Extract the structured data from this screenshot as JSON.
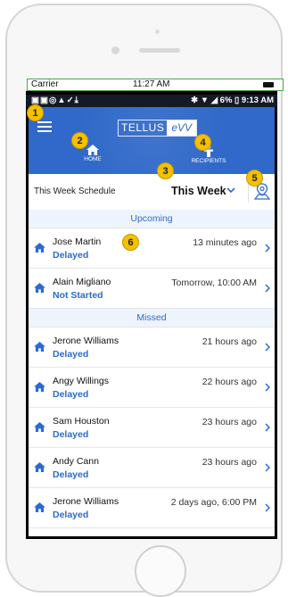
{
  "ios_status": {
    "carrier": "Carrier",
    "time": "11:27 AM"
  },
  "android_status": {
    "left_icons": "▣▣◎▲✓⤓",
    "right": "✱ ▼ ◢ 6% ▯ 9:13 AM"
  },
  "header": {
    "logo_part1": "TELLUS",
    "logo_part2": "eVV",
    "nav": [
      {
        "label": "HOME",
        "icon": "home-icon"
      },
      {
        "label": "RECIPIENTS",
        "icon": "person-icon"
      }
    ],
    "color": "#3069c9"
  },
  "schedule": {
    "label": "This Week Schedule",
    "selected": "This Week"
  },
  "sections": {
    "upcoming": "Upcoming",
    "missed": "Missed"
  },
  "upcoming": [
    {
      "name": "Jose Martin",
      "status": "Delayed",
      "time": "13 minutes ago"
    },
    {
      "name": "Alain  Migliano",
      "status": "Not Started",
      "time": "Tomorrow, 10:00 AM"
    }
  ],
  "missed": [
    {
      "name": "Jerone Williams",
      "status": "Delayed",
      "time": "21 hours ago"
    },
    {
      "name": "Angy Willings",
      "status": "Delayed",
      "time": "22 hours ago"
    },
    {
      "name": "Sam Houston",
      "status": "Delayed",
      "time": "23 hours ago"
    },
    {
      "name": "Andy Cann",
      "status": "Delayed",
      "time": "23 hours ago"
    },
    {
      "name": "Jerone Williams",
      "status": "Delayed",
      "time": "2 days ago, 6:00 PM"
    }
  ],
  "callouts": [
    "1",
    "2",
    "3",
    "4",
    "5",
    "6"
  ],
  "accent": "#2c6ad0",
  "badge_color": "#f5c000"
}
